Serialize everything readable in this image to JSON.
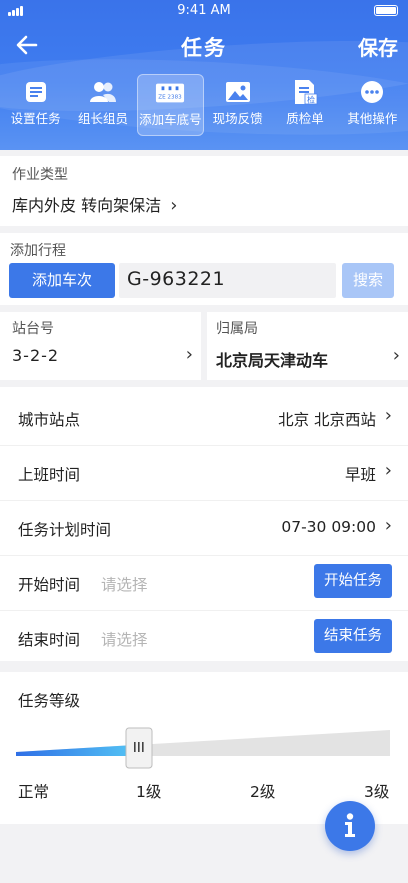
{
  "status": {
    "time": "9:41 AM"
  },
  "nav": {
    "title": "任务",
    "save": "保存"
  },
  "toolbar": [
    {
      "label": "设置任务",
      "icon": "task-list-icon"
    },
    {
      "label": "组长组员",
      "icon": "users-icon"
    },
    {
      "label": "添加车底号",
      "icon": "train-plate-icon",
      "badge": "ZE 2383",
      "active": true
    },
    {
      "label": "现场反馈",
      "icon": "image-icon"
    },
    {
      "label": "质检单",
      "icon": "inspection-doc-icon",
      "badge": "检"
    },
    {
      "label": "其他操作",
      "icon": "more-icon"
    }
  ],
  "work_type": {
    "label": "作业类型",
    "value": "库内外皮 转向架保洁"
  },
  "trip": {
    "label": "添加行程",
    "add_button": "添加车次",
    "train_value": "G-963221",
    "search_button": "搜索"
  },
  "platform": {
    "label": "站台号",
    "value": "3-2-2"
  },
  "bureau": {
    "label": "归属局",
    "value": "北京局天津动车"
  },
  "rows": {
    "city_station": {
      "label": "城市站点",
      "value": "北京 北京西站"
    },
    "shift": {
      "label": "上班时间",
      "value": "早班"
    },
    "plan_time": {
      "label": "任务计划时间",
      "value": "07-30 09:00"
    },
    "start_time": {
      "label": "开始时间",
      "placeholder": "请选择",
      "button": "开始任务"
    },
    "end_time": {
      "label": "结束时间",
      "placeholder": "请选择",
      "button": "结束任务"
    }
  },
  "level": {
    "label": "任务等级",
    "ticks": [
      "正常",
      "1级",
      "2级",
      "3级"
    ],
    "selected": "1级",
    "slider_value_fraction": 0.33
  },
  "colors": {
    "primary": "#3c78e8",
    "disabled": "#a9c6f7"
  }
}
